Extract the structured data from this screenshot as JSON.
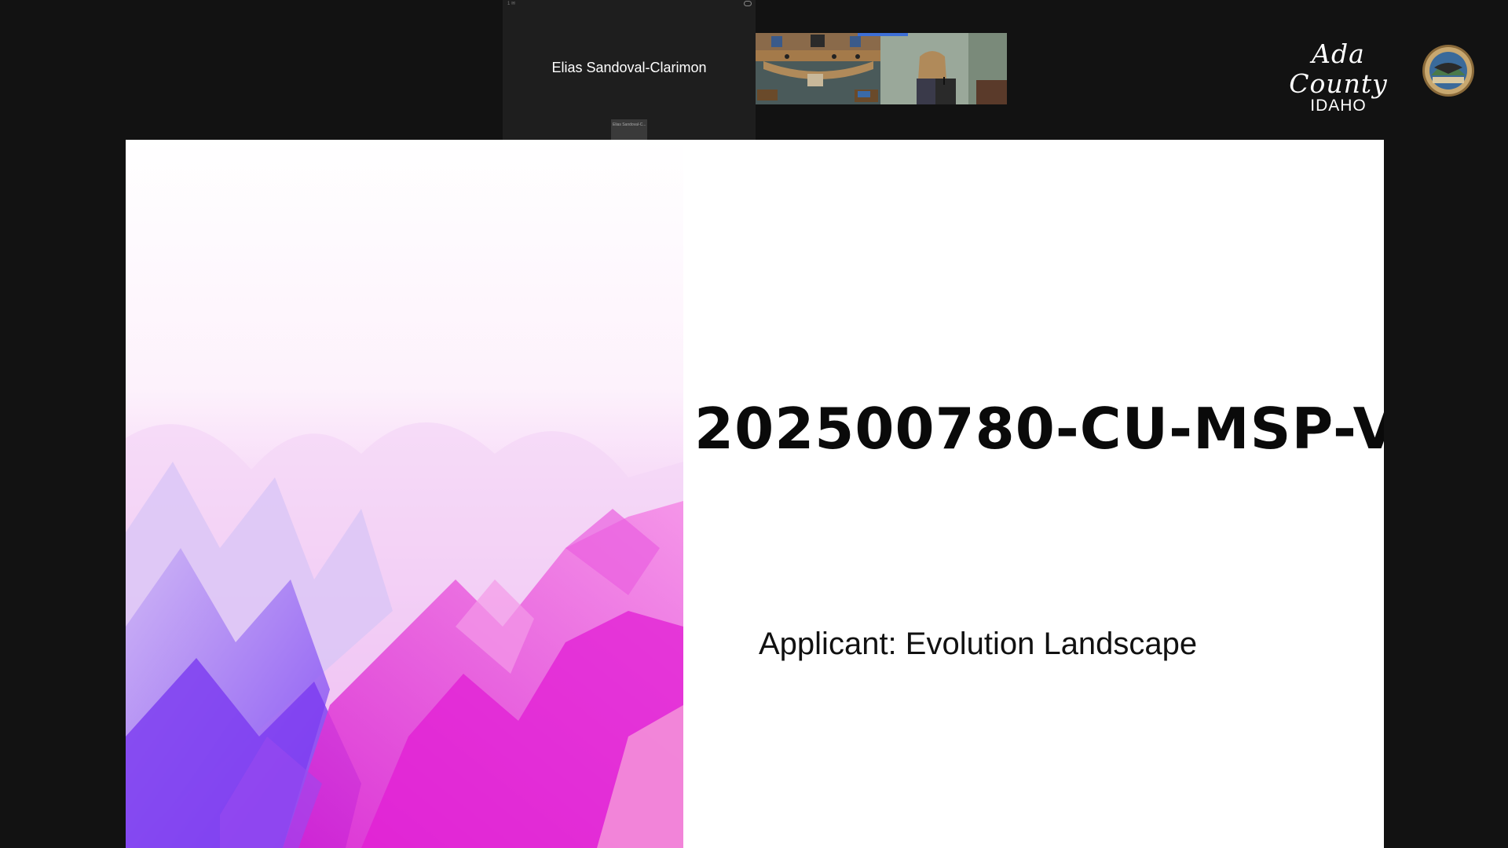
{
  "meeting": {
    "participant_name": "Elias Sandoval-Clarimon",
    "thumbnail_label": "Elias Sandoval-C...",
    "tile_corner_label": "1 ✉"
  },
  "logo": {
    "county": "Ada County",
    "state": "IDAHO"
  },
  "slide": {
    "title": "202500780-CU-MSP-V",
    "subtitle": "Applicant: Evolution Landscape"
  },
  "colors": {
    "background": "#121212",
    "tile": "#1e1e1e",
    "live_indicator": "#3d6fd6",
    "slide_accent_pink": "#e61fd6",
    "slide_accent_violet": "#7a2cf0"
  },
  "icons": [
    "caption-icon",
    "county-seal-icon"
  ]
}
